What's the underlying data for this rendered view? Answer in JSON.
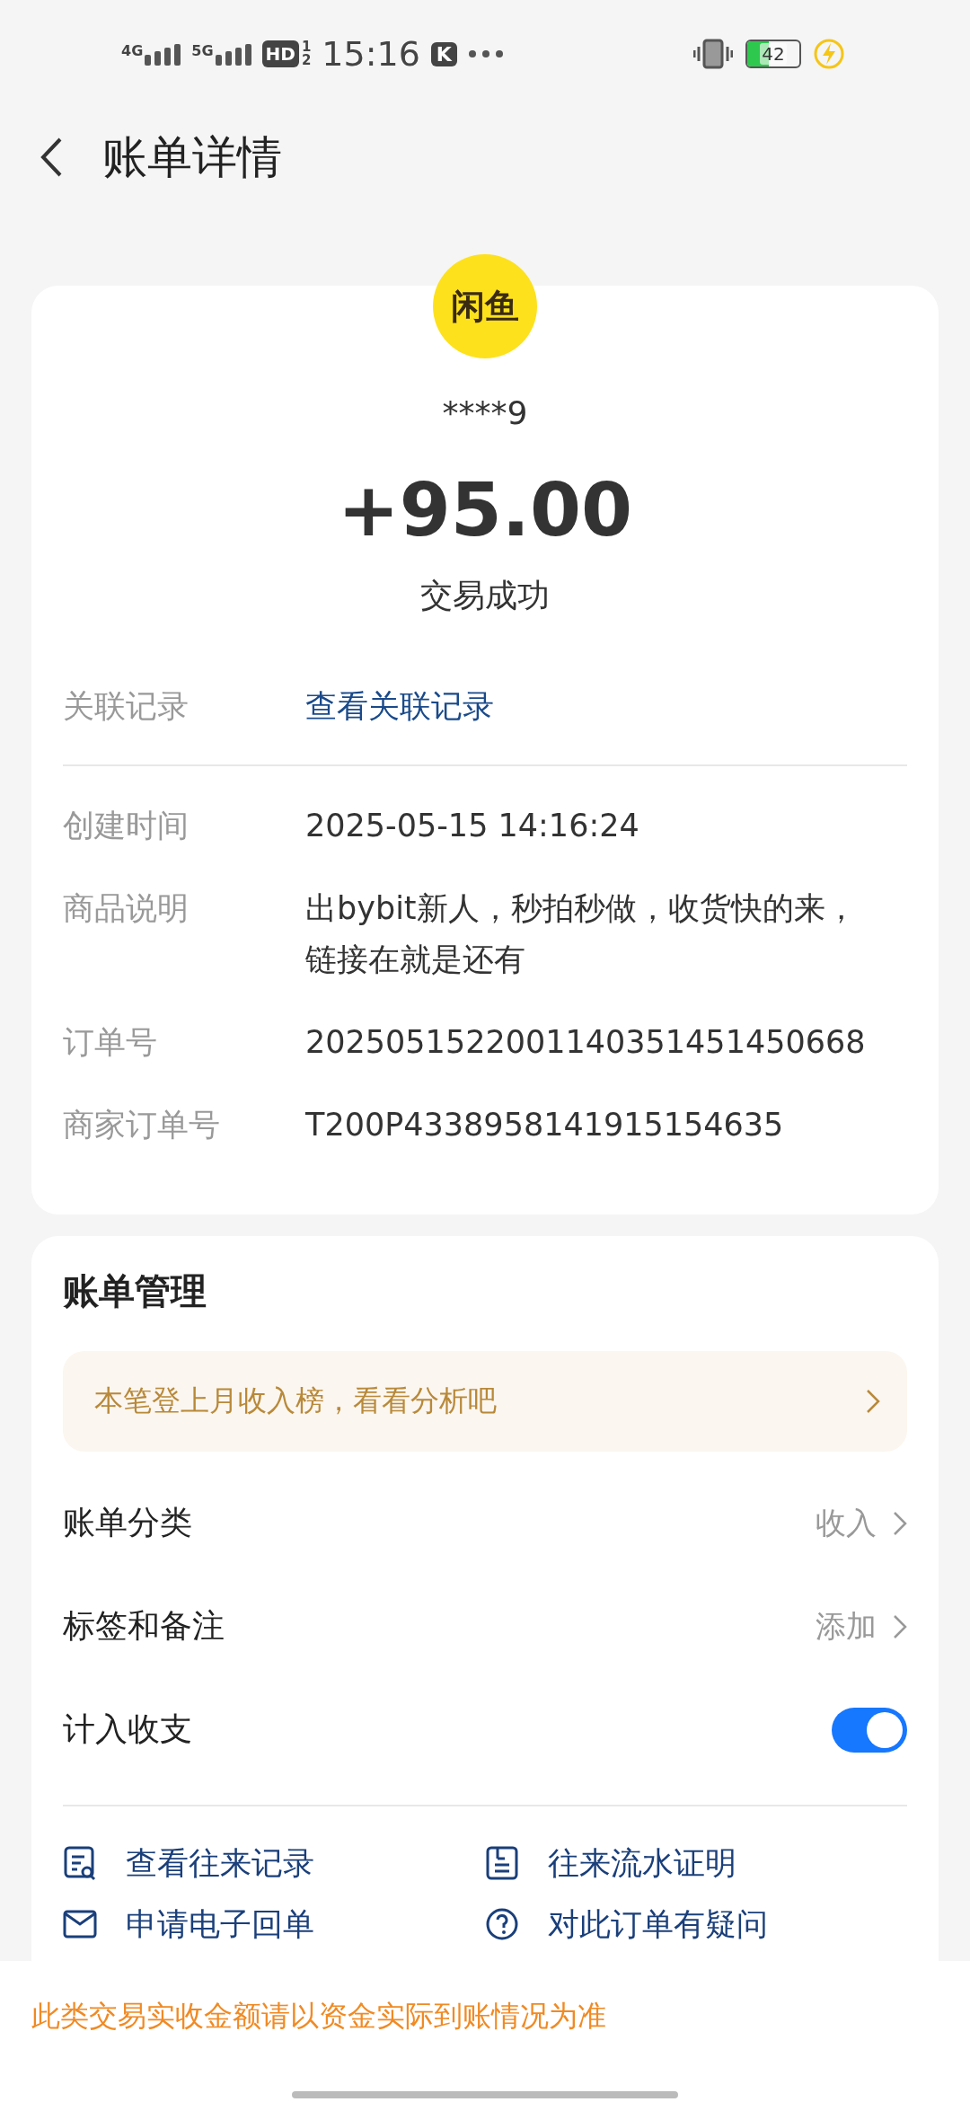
{
  "status_bar": {
    "network_1": "4G",
    "network_2": "5G",
    "hd_badge": "HD",
    "hd_sup": "1",
    "hd_sub": "2",
    "time": "15:16",
    "app_badge": "K",
    "battery": "42",
    "charging": true
  },
  "header": {
    "title": "账单详情"
  },
  "summary": {
    "logo_text": "闲鱼",
    "counterparty": "****9",
    "amount": "+95.00",
    "status": "交易成功"
  },
  "linked": {
    "label": "关联记录",
    "value": "查看关联记录"
  },
  "details": [
    {
      "label": "创建时间",
      "value": "2025-05-15 14:16:24"
    },
    {
      "label": "商品说明",
      "value": "出bybit新人，秒拍秒做，收货快的来，链接在就是还有"
    },
    {
      "label": "订单号",
      "value": "2025051522001140351451450668"
    },
    {
      "label": "商家订单号",
      "value": "T200P4338958141915154635"
    }
  ],
  "management": {
    "title": "账单管理",
    "banner": "本笔登上月收入榜，看看分析吧",
    "rows": [
      {
        "kind": "link",
        "label": "账单分类",
        "value": "收入"
      },
      {
        "kind": "link",
        "label": "标签和备注",
        "value": "添加"
      },
      {
        "kind": "toggle",
        "label": "计入收支",
        "on": true
      }
    ],
    "actions": [
      {
        "kind": "record",
        "label": "查看往来记录"
      },
      {
        "kind": "proof",
        "label": "往来流水证明"
      },
      {
        "kind": "receipt",
        "label": "申请电子回单"
      },
      {
        "kind": "question",
        "label": "对此订单有疑问"
      }
    ]
  },
  "footer_notice": "此类交易实收金额请以资金实际到账情况为准"
}
